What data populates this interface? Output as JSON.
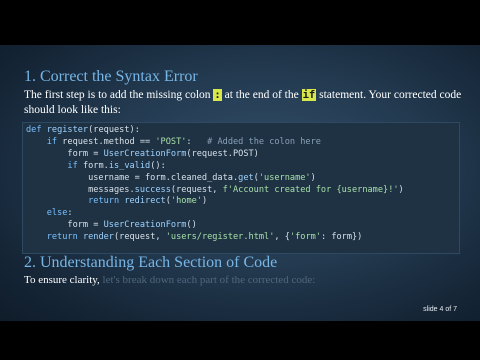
{
  "slide": {
    "heading1": "1. Correct the Syntax Error",
    "intro_a": "The first step is to add the missing colon ",
    "colon_code": ":",
    "intro_b": " at the end of the ",
    "if_code": "if",
    "intro_c": " statement. Your corrected code should look like this:",
    "code_lines": [
      "def register(request):",
      "    if request.method == 'POST':   # Added the colon here",
      "        form = UserCreationForm(request.POST)",
      "        if form.is_valid():",
      "            username = form.cleaned_data.get('username')",
      "            messages.success(request, f'Account created for {username}!')",
      "            return redirect('home')",
      "    else:",
      "        form = UserCreationForm()",
      "    return render(request, 'users/register.html', {'form': form})"
    ],
    "heading2": "2. Understanding Each Section of Code",
    "para2_visible": "To ensure clarity, ",
    "para2_faded": "let's break down each part of the corrected code:",
    "slide_number": "slide 4 of 7"
  }
}
